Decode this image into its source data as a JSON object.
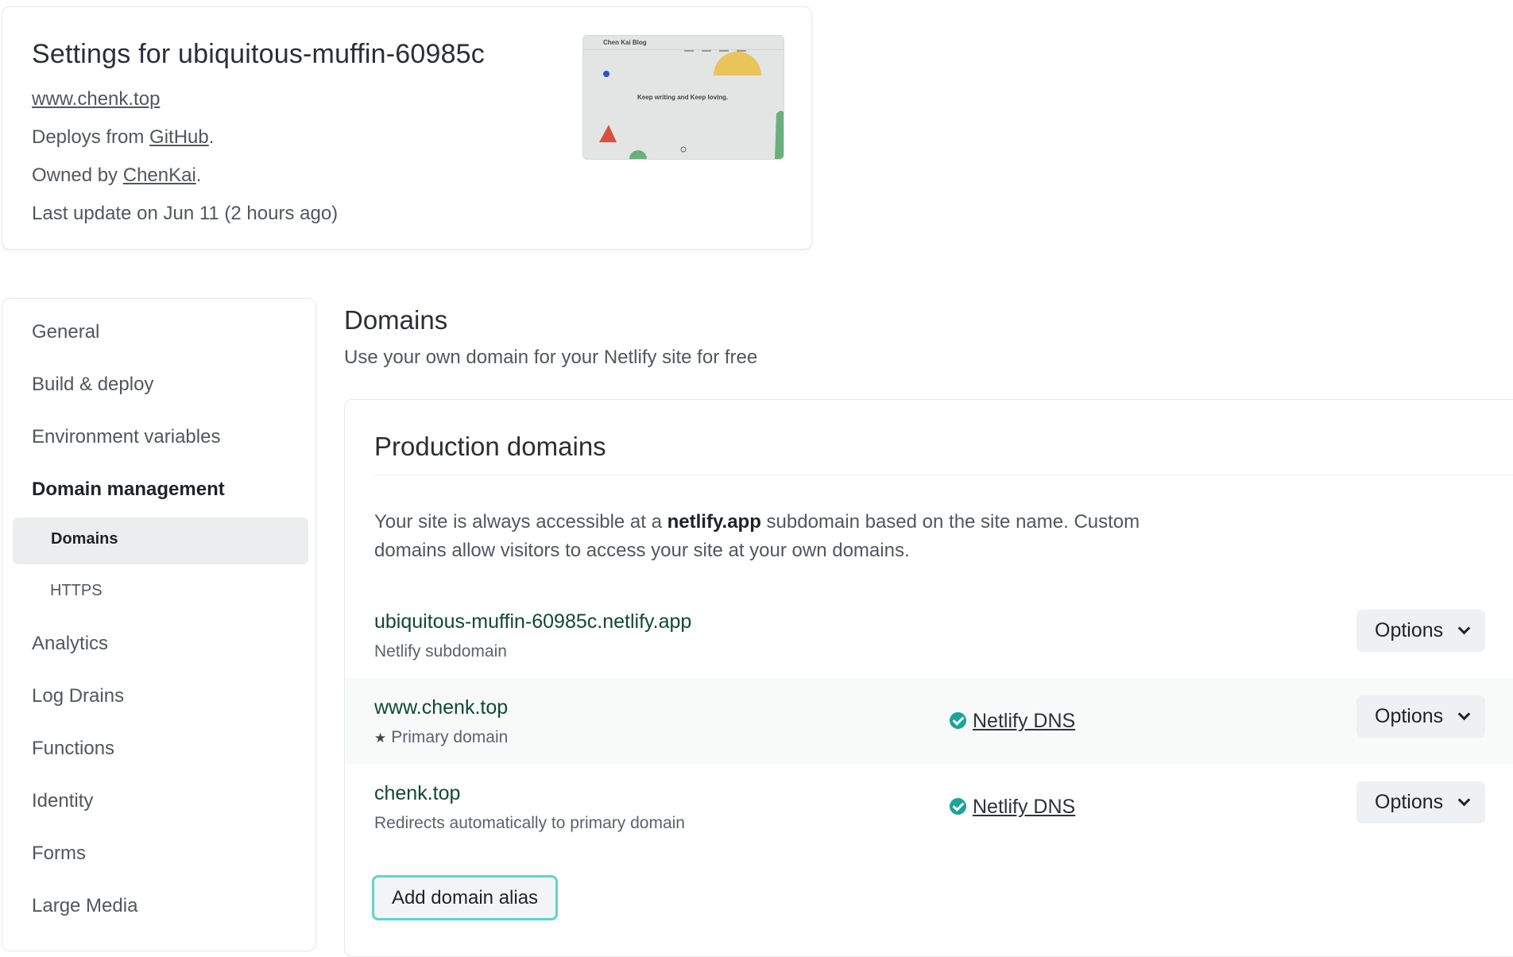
{
  "site": {
    "title": "Settings for ubiquitous-muffin-60985c",
    "url": "www.chenk.top",
    "deploys_prefix": "Deploys from",
    "deploys_link": "GitHub",
    "owned_prefix": "Owned by",
    "owned_link": "ChenKai",
    "last_update": "Last update on Jun 11 (2 hours ago)"
  },
  "preview": {
    "blog_title": "Chen Kai Blog",
    "tagline": "Keep writing and Keep loving."
  },
  "sidebar": {
    "items": [
      {
        "label": "General"
      },
      {
        "label": "Build & deploy"
      },
      {
        "label": "Environment variables"
      },
      {
        "label": "Domain management"
      },
      {
        "label": "Analytics"
      },
      {
        "label": "Log Drains"
      },
      {
        "label": "Functions"
      },
      {
        "label": "Identity"
      },
      {
        "label": "Forms"
      },
      {
        "label": "Large Media"
      }
    ],
    "subitems": [
      {
        "label": "Domains"
      },
      {
        "label": "HTTPS"
      }
    ]
  },
  "main": {
    "title": "Domains",
    "subtitle": "Use your own domain for your Netlify site for free",
    "panel_title": "Production domains",
    "desc_pre": "Your site is always accessible at a ",
    "desc_bold": "netlify.app",
    "desc_post": " subdomain based on the site name. Custom domains allow visitors to access your site at your own domains.",
    "domains": [
      {
        "name": "ubiquitous-muffin-60985c.netlify.app",
        "sub": "Netlify subdomain",
        "dns": ""
      },
      {
        "name": "www.chenk.top",
        "sub": "Primary domain",
        "dns": "Netlify DNS"
      },
      {
        "name": "chenk.top",
        "sub": "Redirects automatically to primary domain",
        "dns": "Netlify DNS"
      }
    ],
    "options_label": "Options",
    "add_alias_label": "Add domain alias"
  },
  "colors": {
    "accent_teal": "#1aa59a",
    "domain_green": "#0d4a35",
    "focus_ring": "#5cd6cf"
  }
}
